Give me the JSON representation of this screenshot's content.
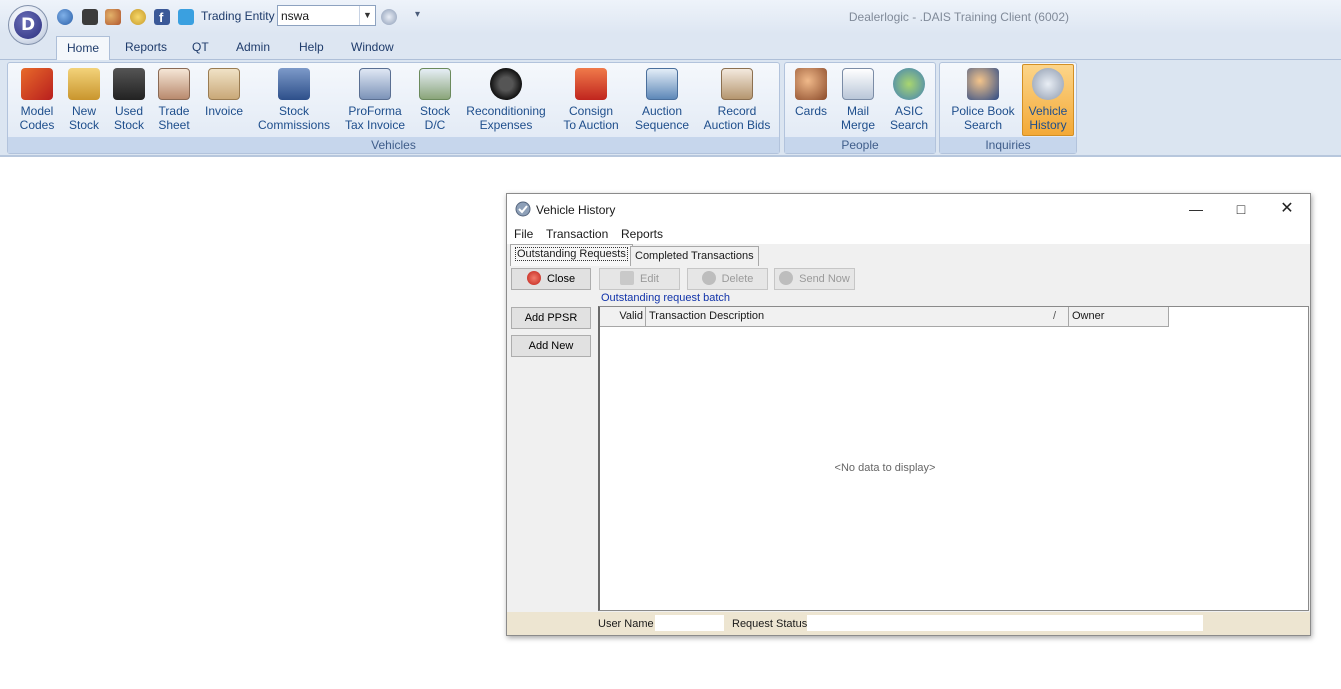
{
  "app": {
    "title": "Dealerlogic - .DAIS Training Client  (6002)",
    "orb_letter": "D"
  },
  "toolbar": {
    "trading_entity_label": "Trading Entity",
    "trading_entity_value": "nswa",
    "quick_icons": [
      "globe-icon",
      "car-icon",
      "people-icon",
      "smiley-icon",
      "facebook-icon",
      "twitter-icon"
    ]
  },
  "menu": {
    "tabs": [
      "Home",
      "Reports",
      "QT",
      "Admin",
      "Help",
      "Window"
    ],
    "active": "Home"
  },
  "ribbon": {
    "groups": [
      {
        "label": "Vehicles",
        "buttons": [
          {
            "line1": "Model",
            "line2": "Codes",
            "icon": "model-codes-icon"
          },
          {
            "line1": "New",
            "line2": "Stock",
            "icon": "new-stock-icon"
          },
          {
            "line1": "Used",
            "line2": "Stock",
            "icon": "used-stock-icon"
          },
          {
            "line1": "Trade",
            "line2": "Sheet",
            "icon": "trade-sheet-icon"
          },
          {
            "line1": "Invoice",
            "line2": "",
            "icon": "invoice-icon"
          },
          {
            "line1": "Stock",
            "line2": "Commissions",
            "icon": "stock-commissions-icon"
          },
          {
            "line1": "ProForma",
            "line2": "Tax Invoice",
            "icon": "proforma-icon"
          },
          {
            "line1": "Stock",
            "line2": "D/C",
            "icon": "stock-dc-icon"
          },
          {
            "line1": "Reconditioning",
            "line2": "Expenses",
            "icon": "tyre-icon"
          },
          {
            "line1": "Consign",
            "line2": "To Auction",
            "icon": "fire-truck-icon"
          },
          {
            "line1": "Auction",
            "line2": "Sequence",
            "icon": "auction-sequence-icon"
          },
          {
            "line1": "Record",
            "line2": "Auction Bids",
            "icon": "record-bids-icon"
          }
        ]
      },
      {
        "label": "People",
        "buttons": [
          {
            "line1": "Cards",
            "line2": "",
            "icon": "cards-icon"
          },
          {
            "line1": "Mail",
            "line2": "Merge",
            "icon": "mail-merge-icon"
          },
          {
            "line1": "ASIC",
            "line2": "Search",
            "icon": "asic-search-icon"
          }
        ]
      },
      {
        "label": "Inquiries",
        "buttons": [
          {
            "line1": "Police Book",
            "line2": "Search",
            "icon": "police-icon"
          },
          {
            "line1": "Vehicle",
            "line2": "History",
            "icon": "vehicle-history-icon"
          }
        ]
      }
    ]
  },
  "dialog": {
    "title": "Vehicle History",
    "menu": [
      "File",
      "Transaction",
      "Reports"
    ],
    "tabs": [
      "Outstanding Requests",
      "Completed Transactions"
    ],
    "active_tab": "Outstanding Requests",
    "buttons": {
      "close": "Close",
      "edit": "Edit",
      "delete": "Delete",
      "send_now": "Send Now",
      "add_ppsr": "Add PPSR",
      "add_new": "Add New"
    },
    "batch_label": "Outstanding request batch",
    "grid": {
      "columns": [
        "Valid",
        "Transaction Description",
        "Owner"
      ],
      "sort_indicator": "/",
      "empty_text": "<No data to display>"
    },
    "status": {
      "user_name_label": "User Name",
      "user_name_value": "",
      "request_status_label": "Request Status",
      "request_status_value": ""
    }
  },
  "colors": {
    "ribbon_text": "#1e4e8c",
    "group_label_bg": "#c6d6ec",
    "selected_button": "#f3a937",
    "link_blue": "#1133aa",
    "status_bar": "#ede5d1"
  }
}
